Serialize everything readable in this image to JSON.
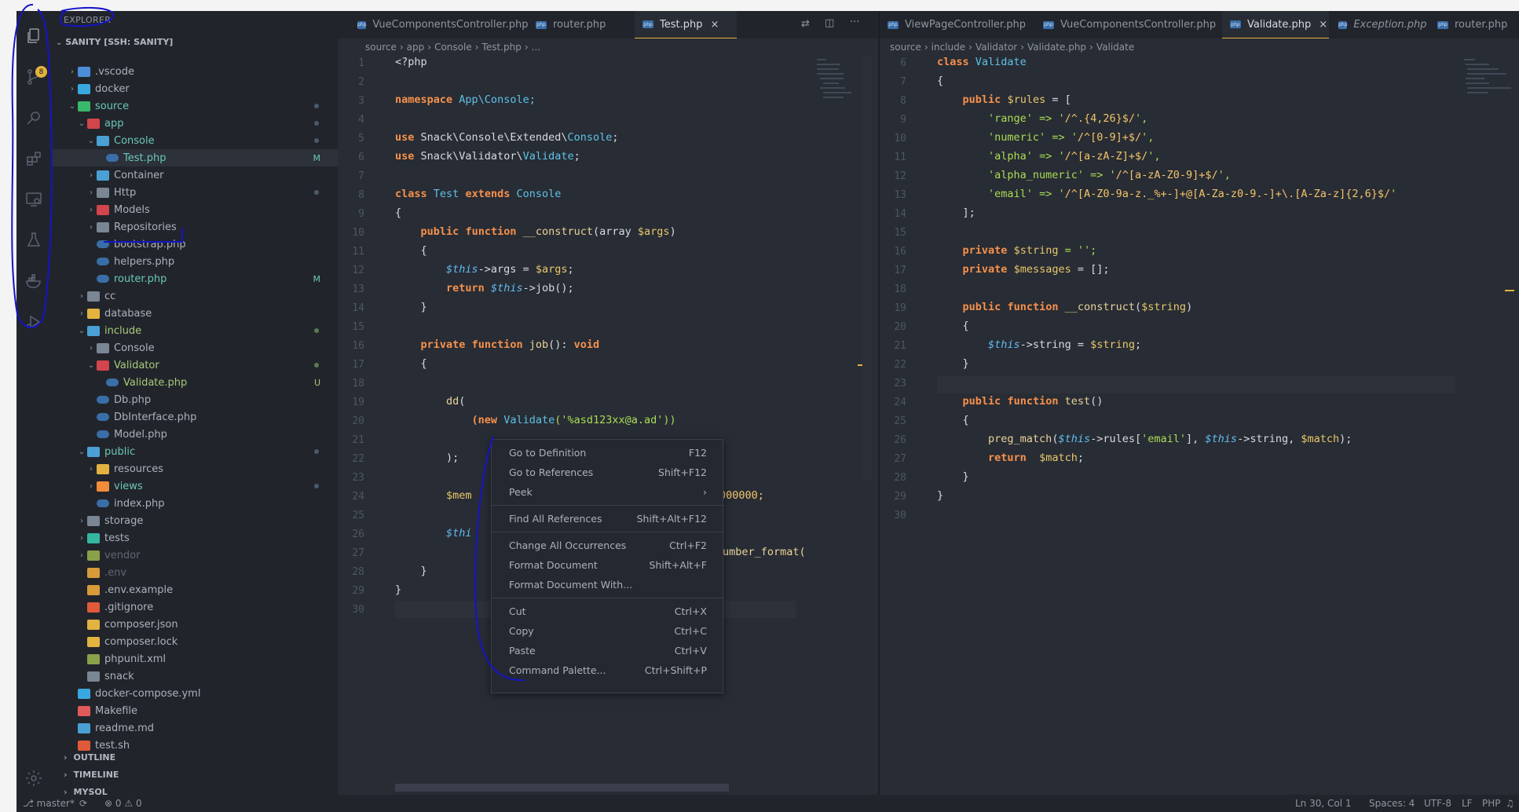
{
  "explorer": {
    "title": "EXPLORER",
    "root": "SANITY [SSH: SANITY]",
    "scm_badge": "8",
    "items": [
      {
        "label": ".vscode",
        "depth": 1,
        "chev": "›",
        "icon": "folder-vscode-icon",
        "color": "#4a8fd8"
      },
      {
        "label": "docker",
        "depth": 1,
        "chev": "›",
        "icon": "folder-docker-icon",
        "color": "#3aa8e0"
      },
      {
        "label": "source",
        "depth": 1,
        "chev": "⌄",
        "icon": "folder-source-icon",
        "color": "#39b86b",
        "dot": true,
        "textColor": "#6cc7b6"
      },
      {
        "label": "app",
        "depth": 2,
        "chev": "⌄",
        "icon": "folder-app-icon",
        "color": "#d2454c",
        "dot": true,
        "textColor": "#6cc7b6"
      },
      {
        "label": "Console",
        "depth": 3,
        "chev": "⌄",
        "icon": "folder-console-icon",
        "color": "#4aa0d5",
        "dot": true,
        "textColor": "#6cc7b6"
      },
      {
        "label": "Test.php",
        "depth": 4,
        "chev": "",
        "icon": "php-file-icon",
        "color": "#3a6ea8",
        "status": "M",
        "statusColor": "#6cc7b6",
        "selected": true,
        "textColor": "#6cc7b6"
      },
      {
        "label": "Container",
        "depth": 3,
        "chev": "›",
        "icon": "folder-container-icon",
        "color": "#4aa0d5"
      },
      {
        "label": "Http",
        "depth": 3,
        "chev": "›",
        "icon": "folder-http-icon",
        "color": "#7a8694",
        "dot": true
      },
      {
        "label": "Models",
        "depth": 3,
        "chev": "›",
        "icon": "folder-models-icon",
        "color": "#d2454c"
      },
      {
        "label": "Repositories",
        "depth": 3,
        "chev": "›",
        "icon": "folder-repositories-icon",
        "color": "#7a8694"
      },
      {
        "label": "bootstrap.php",
        "depth": 3,
        "chev": "",
        "icon": "php-file-icon",
        "color": "#3a6ea8"
      },
      {
        "label": "helpers.php",
        "depth": 3,
        "chev": "",
        "icon": "php-file-icon",
        "color": "#3a6ea8"
      },
      {
        "label": "router.php",
        "depth": 3,
        "chev": "",
        "icon": "php-file-icon",
        "color": "#3a6ea8",
        "status": "M",
        "statusColor": "#6cc7b6",
        "textColor": "#6cc7b6"
      },
      {
        "label": "cc",
        "depth": 2,
        "chev": "›",
        "icon": "folder-icon",
        "color": "#7a8694"
      },
      {
        "label": "database",
        "depth": 2,
        "chev": "›",
        "icon": "folder-database-icon",
        "color": "#e3b341"
      },
      {
        "label": "include",
        "depth": 2,
        "chev": "⌄",
        "icon": "folder-include-icon",
        "color": "#4aa0d5",
        "dot": true,
        "dotColor": "#5a7a4a",
        "textColor": "#a9c97a"
      },
      {
        "label": "Console",
        "depth": 3,
        "chev": "›",
        "icon": "folder-console-icon",
        "color": "#7a8694"
      },
      {
        "label": "Validator",
        "depth": 3,
        "chev": "⌄",
        "icon": "folder-validator-icon",
        "color": "#d2454c",
        "dot": true,
        "dotColor": "#5a7a4a",
        "textColor": "#a9c97a"
      },
      {
        "label": "Validate.php",
        "depth": 4,
        "chev": "",
        "icon": "php-file-icon",
        "color": "#3a6ea8",
        "status": "U",
        "statusColor": "#a9c97a",
        "textColor": "#a9c97a"
      },
      {
        "label": "Db.php",
        "depth": 3,
        "chev": "",
        "icon": "php-file-icon",
        "color": "#3a6ea8"
      },
      {
        "label": "DbInterface.php",
        "depth": 3,
        "chev": "",
        "icon": "php-file-icon",
        "color": "#3a6ea8"
      },
      {
        "label": "Model.php",
        "depth": 3,
        "chev": "",
        "icon": "php-file-icon",
        "color": "#3a6ea8"
      },
      {
        "label": "public",
        "depth": 2,
        "chev": "⌄",
        "icon": "folder-public-icon",
        "color": "#4aa0d5",
        "dot": true,
        "textColor": "#6cc7b6"
      },
      {
        "label": "resources",
        "depth": 3,
        "chev": "›",
        "icon": "folder-resources-icon",
        "color": "#e3b341"
      },
      {
        "label": "views",
        "depth": 3,
        "chev": "›",
        "icon": "folder-views-icon",
        "color": "#f08c3a",
        "dot": true,
        "textColor": "#6cc7b6"
      },
      {
        "label": "index.php",
        "depth": 3,
        "chev": "",
        "icon": "php-file-icon",
        "color": "#3a6ea8"
      },
      {
        "label": "storage",
        "depth": 2,
        "chev": "›",
        "icon": "folder-storage-icon",
        "color": "#7a8694"
      },
      {
        "label": "tests",
        "depth": 2,
        "chev": "›",
        "icon": "folder-tests-icon",
        "color": "#34b6a3"
      },
      {
        "label": "vendor",
        "depth": 2,
        "chev": "›",
        "icon": "folder-vendor-icon",
        "color": "#8aa04a",
        "textColor": "#5f6672"
      },
      {
        "label": ".env",
        "depth": 2,
        "chev": "",
        "icon": "env-file-icon",
        "color": "#d99a3a",
        "textColor": "#5f6672"
      },
      {
        "label": ".env.example",
        "depth": 2,
        "chev": "",
        "icon": "env-file-icon",
        "color": "#d99a3a"
      },
      {
        "label": ".gitignore",
        "depth": 2,
        "chev": "",
        "icon": "git-file-icon",
        "color": "#e05a3a"
      },
      {
        "label": "composer.json",
        "depth": 2,
        "chev": "",
        "icon": "json-file-icon",
        "color": "#e3b341"
      },
      {
        "label": "composer.lock",
        "depth": 2,
        "chev": "",
        "icon": "json-file-icon",
        "color": "#e3b341"
      },
      {
        "label": "phpunit.xml",
        "depth": 2,
        "chev": "",
        "icon": "xml-file-icon",
        "color": "#8aa04a"
      },
      {
        "label": "snack",
        "depth": 2,
        "chev": "",
        "icon": "file-icon",
        "color": "#7a8694"
      },
      {
        "label": "docker-compose.yml",
        "depth": 1,
        "chev": "",
        "icon": "docker-file-icon",
        "color": "#3aa8e0"
      },
      {
        "label": "Makefile",
        "depth": 1,
        "chev": "",
        "icon": "makefile-icon",
        "color": "#e05a5a"
      },
      {
        "label": "readme.md",
        "depth": 1,
        "chev": "",
        "icon": "info-file-icon",
        "color": "#4aa0d5"
      },
      {
        "label": "test.sh",
        "depth": 1,
        "chev": "",
        "icon": "shell-file-icon",
        "color": "#e05a3a"
      }
    ],
    "sections": [
      "OUTLINE",
      "TIMELINE",
      "MYSQL"
    ]
  },
  "left_editor": {
    "tabs": [
      {
        "label": "VueComponentsController.php"
      },
      {
        "label": "router.php"
      },
      {
        "label": "Test.php",
        "active": true
      }
    ],
    "close": "×",
    "breadcrumb": [
      "source",
      "app",
      "Console",
      "Test.php",
      "..."
    ],
    "line_numbers": [
      "1",
      "2",
      "3",
      "4",
      "5",
      "6",
      "7",
      "8",
      "9",
      "10",
      "11",
      "12",
      "13",
      "14",
      "15",
      "16",
      "17",
      "18",
      "19",
      "20",
      "21",
      "22",
      "23",
      "24",
      "25",
      "26",
      "27",
      "28",
      "29",
      "30"
    ]
  },
  "right_editor": {
    "tabs": [
      {
        "label": "ViewPageController.php"
      },
      {
        "label": "VueComponentsController.php"
      },
      {
        "label": "Validate.php",
        "active": true
      },
      {
        "label": "Exception.php",
        "italic": true
      },
      {
        "label": "router.php"
      }
    ],
    "breadcrumb": [
      "source",
      "include",
      "Validator",
      "Validate.php",
      "Validate"
    ],
    "line_numbers": [
      "6",
      "7",
      "8",
      "9",
      "10",
      "11",
      "12",
      "13",
      "14",
      "15",
      "16",
      "17",
      "18",
      "19",
      "20",
      "21",
      "22",
      "23",
      "24",
      "25",
      "26",
      "27",
      "28",
      "29",
      "30"
    ]
  },
  "context_menu": {
    "items": [
      {
        "label": "Go to Definition",
        "shortcut": "F12"
      },
      {
        "label": "Go to References",
        "shortcut": "Shift+F12"
      },
      {
        "label": "Peek",
        "shortcut": "›"
      },
      {
        "label": "Find All References",
        "shortcut": "Shift+Alt+F12"
      },
      {
        "label": "Change All Occurrences",
        "shortcut": "Ctrl+F2"
      },
      {
        "label": "Format Document",
        "shortcut": "Shift+Alt+F"
      },
      {
        "label": "Format Document With...",
        "shortcut": ""
      },
      {
        "label": "Cut",
        "shortcut": "Ctrl+X"
      },
      {
        "label": "Copy",
        "shortcut": "Ctrl+C"
      },
      {
        "label": "Paste",
        "shortcut": "Ctrl+V"
      },
      {
        "label": "Command Palette...",
        "shortcut": "Ctrl+Shift+P"
      }
    ]
  },
  "code_left": {
    "l1": "<?php",
    "l3a": "namespace",
    "l3b": "App\\Console;",
    "l5a": "use",
    "l5b": "Snack\\Console\\Extended\\",
    "l5c": "Console",
    "l6a": "use",
    "l6b": "Snack\\Validator\\",
    "l6c": "Validate",
    "l8a": "class",
    "l8b": "Test",
    "l8c": "extends",
    "l8d": "Console",
    "l9": "{",
    "l10a": "public",
    "l10b": "function",
    "l10c": "__construct",
    "l10d": "(array ",
    "l10e": "$args",
    "l10f": ")",
    "l11": "{",
    "l12a": "$this",
    "l12b": "->args = ",
    "l12c": "$args",
    "l12d": ";",
    "l13a": "return",
    "l13b": "$this",
    "l13c": "->job();",
    "l14": "}",
    "l16a": "private",
    "l16b": "function",
    "l16c": "job",
    "l16d": "(): ",
    "l16e": "void",
    "l17": "{",
    "l19a": "dd",
    "l19b": "(",
    "l20a": "(new",
    "l20b": "Validate",
    "l20c": "('",
    "l20d": "%asd123xx@a.ad",
    "l20e": "'))",
    "l22": ");",
    "l24a": "$mem",
    "l24b": "000000;",
    "l26": "$thi",
    "l27": "umber_format(",
    "l28": "}",
    "l29": "}"
  },
  "code_right": {
    "l6a": "class",
    "l6b": "Validate",
    "l7": "{",
    "l8a": "public",
    "l8b": "$rules",
    "l8c": "= [",
    "l9a": "'range'",
    "l9b": "=> '",
    "l9c": "/^.{4,26}$/",
    "l9d": "',",
    "l10a": "'numeric'",
    "l10b": "=> '",
    "l10c": "/^[0-9]+$/",
    "l10d": "',",
    "l11a": "'alpha'",
    "l11b": "=> '",
    "l11c": "/^[a-zA-Z]+$/",
    "l11d": "',",
    "l12a": "'alpha_numeric'",
    "l12b": "=> '",
    "l12c": "/^[a-zA-Z0-9]+$/",
    "l12d": "',",
    "l13a": "'email'",
    "l13b": "=> '",
    "l13c": "/^[A-Z0-9a-z._%+-]+@[A-Za-z0-9.-]+\\.[A-Za-z]{2,6}$/",
    "l13d": "'",
    "l14": "];",
    "l16a": "private",
    "l16b": "$string",
    "l16c": "= '';",
    "l17a": "private",
    "l17b": "$messages",
    "l17c": "= [];",
    "l19a": "public",
    "l19b": "function",
    "l19c": "__construct",
    "l19d": "(",
    "l19e": "$string",
    "l19f": ")",
    "l20": "{",
    "l21a": "$this",
    "l21b": "->string = ",
    "l21c": "$string",
    "l21d": ";",
    "l22": "}",
    "l24a": "public",
    "l24b": "function",
    "l24c": "test",
    "l24d": "()",
    "l25": "{",
    "l26a": "preg_match",
    "l26b": "(",
    "l26c": "$this",
    "l26d": "->rules[",
    "l26e": "'email'",
    "l26f": "], ",
    "l26g": "$this",
    "l26h": "->string, ",
    "l26i": "$match",
    "l26j": ");",
    "l27a": "return",
    "l27b": "$match",
    "l27c": ";",
    "l28": "}",
    "l29": "}"
  },
  "status_bar": {
    "branch": "master*",
    "problems": "0",
    "warnings": "0",
    "cursor": "Ln 30, Col 1",
    "spaces": "Spaces: 4",
    "encoding": "UTF-8",
    "eol": "LF",
    "language": "PHP"
  },
  "colors": {
    "annotation_pen": "#1010c8",
    "accent": "#e5b33f"
  }
}
